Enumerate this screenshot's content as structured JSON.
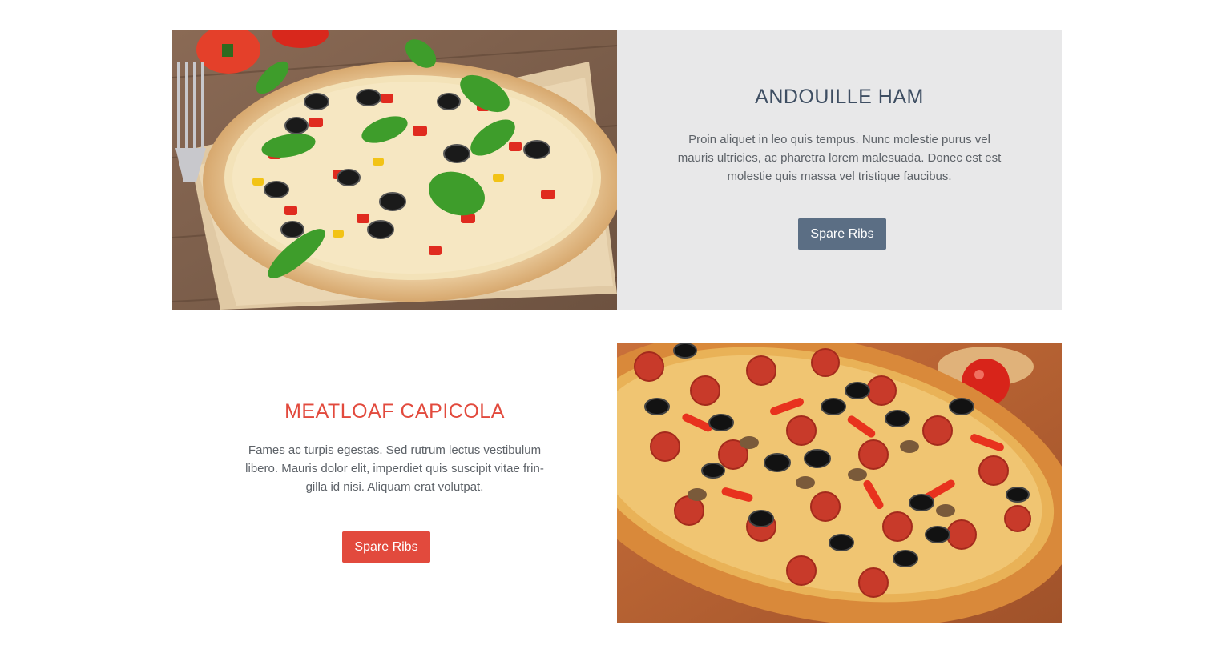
{
  "sections": [
    {
      "title": "ANDOUILLE HAM",
      "description": "Proin aliquet in leo quis tempus. Nunc molestie purus vel mauris ultricies, ac pharetra lorem malesuada. Donec est est molestie quis massa vel tristique faucibus.",
      "button_label": "Spare Ribs",
      "accent": "#5b6e84",
      "title_color": "#3e4e62",
      "image_icon": "vegetable-pizza-image"
    },
    {
      "title": "MEATLOAF CAPICOLA",
      "description": "Fames ac turpis egestas. Sed rutrum lectus vestibulum libero. Mauris dolor elit, imperdiet quis suscipit vitae frin-gilla id nisi. Aliquam erat volutpat.",
      "button_label": "Spare Ribs",
      "accent": "#e24a3d",
      "title_color": "#e24a3d",
      "image_icon": "pepperoni-pizza-image"
    }
  ]
}
